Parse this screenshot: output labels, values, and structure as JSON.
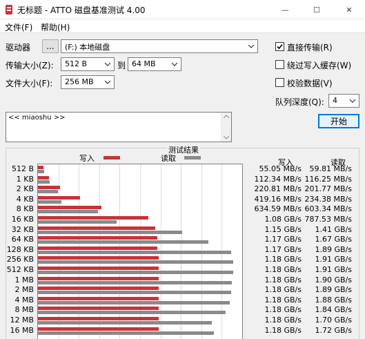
{
  "window": {
    "title": "无标题 - ATTO 磁盘基准测试 4.00",
    "min_glyph": "—",
    "max_glyph": "☐",
    "close_glyph": "✕"
  },
  "menu": {
    "file": "文件(F)",
    "help": "帮助(H)"
  },
  "controls": {
    "drive_label": "驱动器",
    "browse_label": "...",
    "drive_value": "(F:) 本地磁盘",
    "transfer_label": "传输大小(Z):",
    "transfer_from": "512 B",
    "to_label": "到",
    "transfer_to": "64 MB",
    "filesize_label": "文件大小(F):",
    "filesize_value": "256 MB",
    "direct_io_label": "直接传输(R)",
    "direct_io_checked": true,
    "bypass_cache_label": "绕过写入缓存(W)",
    "bypass_cache_checked": false,
    "verify_label": "校验数据(V)",
    "verify_checked": false,
    "queue_label": "队列深度(Q):",
    "queue_value": "4",
    "start_label": "开始",
    "description": "<< miaoshu >>"
  },
  "results": {
    "title": "测试结果",
    "write_header": "写入",
    "read_header": "读取",
    "legend_write": "写入",
    "legend_read": "读取"
  },
  "chart_data": {
    "type": "bar",
    "orientation": "horizontal",
    "categories": [
      "512 B",
      "1 KB",
      "2 KB",
      "4 KB",
      "8 KB",
      "16 KB",
      "32 KB",
      "64 KB",
      "128 KB",
      "256 KB",
      "512 KB",
      "1 MB",
      "2 MB",
      "4 MB",
      "8 MB",
      "12 MB",
      "16 MB"
    ],
    "series": [
      {
        "name": "写入",
        "color": "#c8323a",
        "values_mbps": [
          55.05,
          112.34,
          220.81,
          419.16,
          634.59,
          1105.9,
          1177.6,
          1198.1,
          1198.1,
          1208.3,
          1208.3,
          1208.3,
          1208.3,
          1208.3,
          1208.3,
          1208.3,
          1208.3
        ],
        "labels": [
          "55.05 MB/s",
          "112.34 MB/s",
          "220.81 MB/s",
          "419.16 MB/s",
          "634.59 MB/s",
          "1.08 GB/s",
          "1.15 GB/s",
          "1.17 GB/s",
          "1.17 GB/s",
          "1.18 GB/s",
          "1.18 GB/s",
          "1.18 GB/s",
          "1.18 GB/s",
          "1.18 GB/s",
          "1.18 GB/s",
          "1.18 GB/s",
          "1.18 GB/s"
        ]
      },
      {
        "name": "读取",
        "color": "#8a8a8a",
        "values_mbps": [
          59.81,
          116.25,
          201.77,
          234.38,
          603.34,
          787.53,
          1443.8,
          1710.1,
          1935.4,
          1955.8,
          1955.8,
          1945.6,
          1935.4,
          1925.1,
          1884.2,
          1740.8,
          1761.3
        ],
        "labels": [
          "59.81 MB/s",
          "116.25 MB/s",
          "201.77 MB/s",
          "234.38 MB/s",
          "603.34 MB/s",
          "787.53 MB/s",
          "1.41 GB/s",
          "1.67 GB/s",
          "1.89 GB/s",
          "1.91 GB/s",
          "1.91 GB/s",
          "1.90 GB/s",
          "1.89 GB/s",
          "1.88 GB/s",
          "1.84 GB/s",
          "1.70 GB/s",
          "1.72 GB/s"
        ]
      }
    ],
    "xlim_mbps": [
      0,
      2048
    ],
    "grid": true
  }
}
